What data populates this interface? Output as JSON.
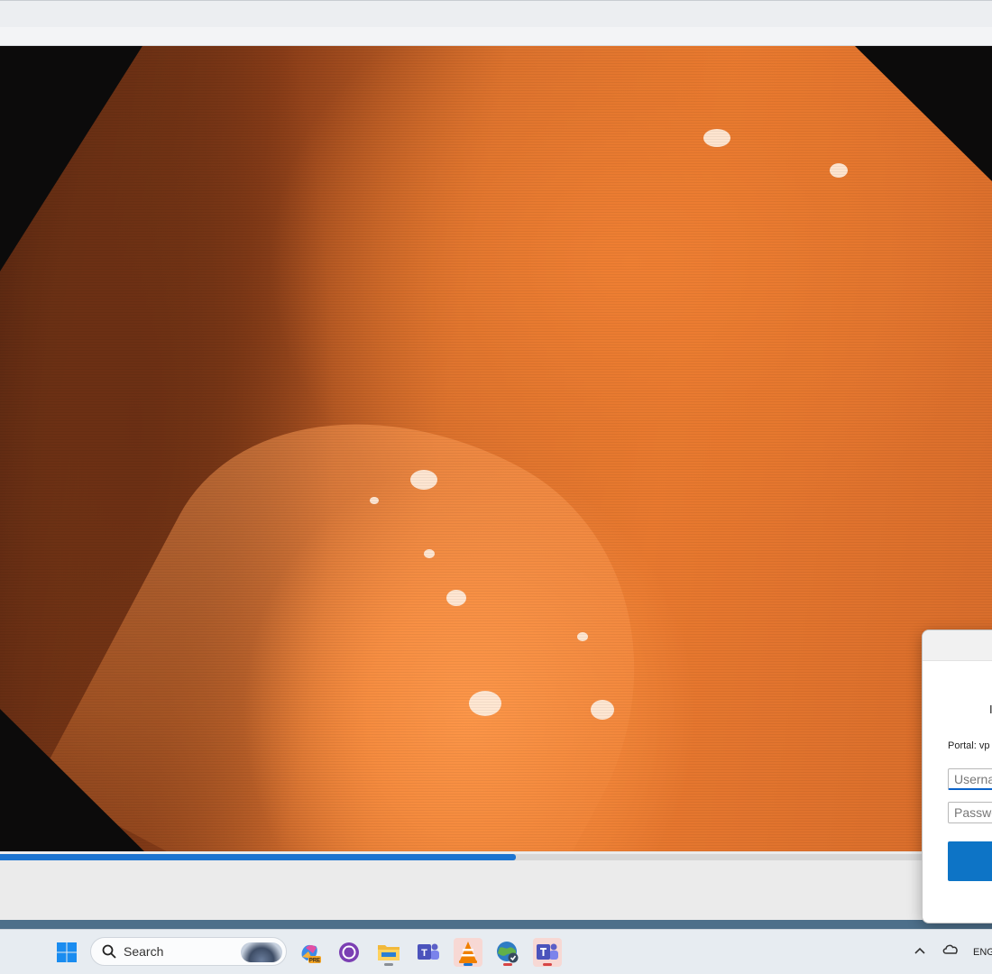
{
  "video": {
    "progress": 0.52
  },
  "dialog": {
    "heading_fragment": "I",
    "portal_label": "Portal: vp",
    "username_placeholder": "Userna",
    "password_placeholder": "Passwo",
    "connect_label": ""
  },
  "taskbar": {
    "search_label": "Search",
    "apps": [
      {
        "name": "copilot-icon",
        "badge": "PRE"
      },
      {
        "name": "github-desktop-icon"
      },
      {
        "name": "file-explorer-icon"
      },
      {
        "name": "teams-work-icon",
        "letter": "T"
      },
      {
        "name": "vlc-icon",
        "active": true
      },
      {
        "name": "vpn-globe-icon"
      },
      {
        "name": "teams-icon"
      }
    ],
    "tray_language": "ENG"
  },
  "colors": {
    "accent": "#1c74d0",
    "progress": "#1c74d0",
    "connect_button": "#0d74c6",
    "tissue": "#e9792f"
  }
}
